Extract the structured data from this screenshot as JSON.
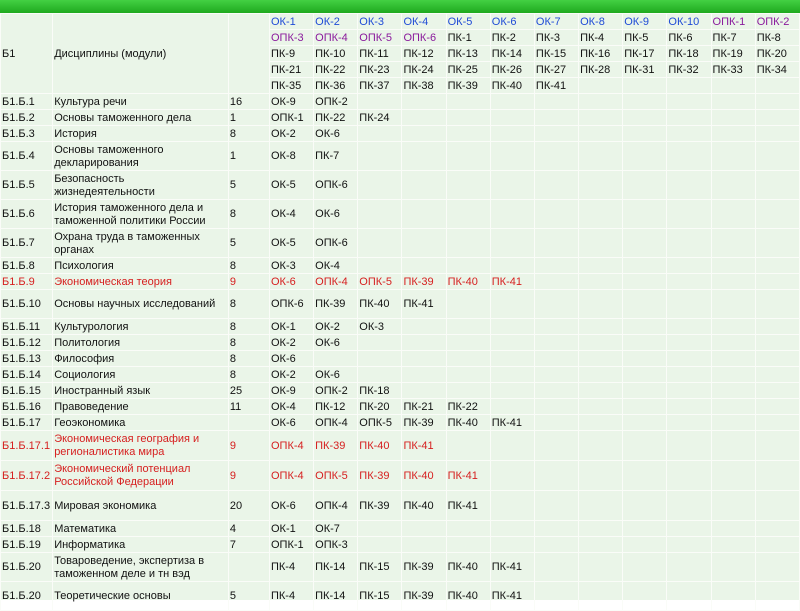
{
  "header": {
    "code": "Б1",
    "title": "Дисциплины (модули)",
    "rows": [
      [
        {
          "t": "ОК-1",
          "c": "blue"
        },
        {
          "t": "ОК-2",
          "c": "blue"
        },
        {
          "t": "ОК-3",
          "c": "blue"
        },
        {
          "t": "ОК-4",
          "c": "blue"
        },
        {
          "t": "ОК-5",
          "c": "blue"
        },
        {
          "t": "ОК-6",
          "c": "blue"
        },
        {
          "t": "ОК-7",
          "c": "blue"
        },
        {
          "t": "ОК-8",
          "c": "blue"
        },
        {
          "t": "ОК-9",
          "c": "blue"
        },
        {
          "t": "ОК-10",
          "c": "blue"
        },
        {
          "t": "ОПК-1",
          "c": "purple"
        },
        {
          "t": "ОПК-2",
          "c": "purple"
        }
      ],
      [
        {
          "t": "ОПК-3",
          "c": "purple"
        },
        {
          "t": "ОПК-4",
          "c": "purple"
        },
        {
          "t": "ОПК-5",
          "c": "purple"
        },
        {
          "t": "ОПК-6",
          "c": "purple"
        },
        {
          "t": "ПК-1",
          "c": ""
        },
        {
          "t": "ПК-2",
          "c": ""
        },
        {
          "t": "ПК-3",
          "c": ""
        },
        {
          "t": "ПК-4",
          "c": ""
        },
        {
          "t": "ПК-5",
          "c": ""
        },
        {
          "t": "ПК-6",
          "c": ""
        },
        {
          "t": "ПК-7",
          "c": ""
        },
        {
          "t": "ПК-8",
          "c": ""
        }
      ],
      [
        {
          "t": "ПК-9",
          "c": ""
        },
        {
          "t": "ПК-10",
          "c": ""
        },
        {
          "t": "ПК-11",
          "c": ""
        },
        {
          "t": "ПК-12",
          "c": ""
        },
        {
          "t": "ПК-13",
          "c": ""
        },
        {
          "t": "ПК-14",
          "c": ""
        },
        {
          "t": "ПК-15",
          "c": ""
        },
        {
          "t": "ПК-16",
          "c": ""
        },
        {
          "t": "ПК-17",
          "c": ""
        },
        {
          "t": "ПК-18",
          "c": ""
        },
        {
          "t": "ПК-19",
          "c": ""
        },
        {
          "t": "ПК-20",
          "c": ""
        }
      ],
      [
        {
          "t": "ПК-21",
          "c": ""
        },
        {
          "t": "ПК-22",
          "c": ""
        },
        {
          "t": "ПК-23",
          "c": ""
        },
        {
          "t": "ПК-24",
          "c": ""
        },
        {
          "t": "ПК-25",
          "c": ""
        },
        {
          "t": "ПК-26",
          "c": ""
        },
        {
          "t": "ПК-27",
          "c": ""
        },
        {
          "t": "ПК-28",
          "c": ""
        },
        {
          "t": "ПК-31",
          "c": ""
        },
        {
          "t": "ПК-32",
          "c": ""
        },
        {
          "t": "ПК-33",
          "c": ""
        },
        {
          "t": "ПК-34",
          "c": ""
        }
      ],
      [
        {
          "t": "ПК-35",
          "c": ""
        },
        {
          "t": "ПК-36",
          "c": ""
        },
        {
          "t": "ПК-37",
          "c": ""
        },
        {
          "t": "ПК-38",
          "c": ""
        },
        {
          "t": "ПК-39",
          "c": ""
        },
        {
          "t": "ПК-40",
          "c": ""
        },
        {
          "t": "ПК-41",
          "c": ""
        },
        {
          "t": "",
          "c": ""
        },
        {
          "t": "",
          "c": ""
        },
        {
          "t": "",
          "c": ""
        },
        {
          "t": "",
          "c": ""
        },
        {
          "t": "",
          "c": ""
        }
      ]
    ]
  },
  "rows": [
    {
      "code": "Б1.Б.1",
      "name": "Культура речи",
      "hours": "16",
      "comps": [
        "ОК-9",
        "ОПК-2"
      ],
      "red": false,
      "h": 1
    },
    {
      "code": "Б1.Б.2",
      "name": "Основы таможенного дела",
      "hours": "1",
      "comps": [
        "ОПК-1",
        "ПК-22",
        "ПК-24"
      ],
      "red": false,
      "h": 1
    },
    {
      "code": "Б1.Б.3",
      "name": "История",
      "hours": "8",
      "comps": [
        "ОК-2",
        "ОК-6"
      ],
      "red": false,
      "h": 1
    },
    {
      "code": "Б1.Б.4",
      "name": "Основы таможенного декларирования",
      "hours": "1",
      "comps": [
        "ОК-8",
        "ПК-7"
      ],
      "red": false,
      "h": 2
    },
    {
      "code": "Б1.Б.5",
      "name": "Безопасность жизнедеятельности",
      "hours": "5",
      "comps": [
        "ОК-5",
        "ОПК-6"
      ],
      "red": false,
      "h": 2
    },
    {
      "code": "Б1.Б.6",
      "name": "История таможенного дела и таможенной политики России",
      "hours": "8",
      "comps": [
        "ОК-4",
        "ОК-6"
      ],
      "red": false,
      "h": 2
    },
    {
      "code": "Б1.Б.7",
      "name": "Охрана труда в таможенных органах",
      "hours": "5",
      "comps": [
        "ОК-5",
        "ОПК-6"
      ],
      "red": false,
      "h": 2
    },
    {
      "code": "Б1.Б.8",
      "name": "Психология",
      "hours": "8",
      "comps": [
        "ОК-3",
        "ОК-4"
      ],
      "red": false,
      "h": 1
    },
    {
      "code": "Б1.Б.9",
      "name": "Экономическая теория",
      "hours": "9",
      "comps": [
        "ОК-6",
        "ОПК-4",
        "ОПК-5",
        "ПК-39",
        "ПК-40",
        "ПК-41"
      ],
      "red": true,
      "h": 1
    },
    {
      "code": "Б1.Б.10",
      "name": "Основы научных исследований",
      "hours": "8",
      "comps": [
        "ОПК-6",
        "ПК-39",
        "ПК-40",
        "ПК-41"
      ],
      "red": false,
      "h": 2
    },
    {
      "code": "Б1.Б.11",
      "name": "Культурология",
      "hours": "8",
      "comps": [
        "ОК-1",
        "ОК-2",
        "ОК-3"
      ],
      "red": false,
      "h": 1
    },
    {
      "code": "Б1.Б.12",
      "name": "Политология",
      "hours": "8",
      "comps": [
        "ОК-2",
        "ОК-6"
      ],
      "red": false,
      "h": 1
    },
    {
      "code": "Б1.Б.13",
      "name": "Философия",
      "hours": "8",
      "comps": [
        "ОК-6"
      ],
      "red": false,
      "h": 1
    },
    {
      "code": "Б1.Б.14",
      "name": "Социология",
      "hours": "8",
      "comps": [
        "ОК-2",
        "ОК-6"
      ],
      "red": false,
      "h": 1
    },
    {
      "code": "Б1.Б.15",
      "name": "Иностранный язык",
      "hours": "25",
      "comps": [
        "ОК-9",
        "ОПК-2",
        "ПК-18"
      ],
      "red": false,
      "h": 1
    },
    {
      "code": "Б1.Б.16",
      "name": "Правоведение",
      "hours": "11",
      "comps": [
        "ОК-4",
        "ПК-12",
        "ПК-20",
        "ПК-21",
        "ПК-22"
      ],
      "red": false,
      "h": 1
    },
    {
      "code": "Б1.Б.17",
      "name": "Геоэкономика",
      "hours": "",
      "comps": [
        "ОК-6",
        "ОПК-4",
        "ОПК-5",
        "ПК-39",
        "ПК-40",
        "ПК-41"
      ],
      "red": false,
      "h": 1
    },
    {
      "code": "Б1.Б.17.1",
      "name": "Экономическая география и регионалистика мира",
      "hours": "9",
      "comps": [
        "ОПК-4",
        "ПК-39",
        "ПК-40",
        "ПК-41"
      ],
      "red": true,
      "h": 3
    },
    {
      "code": "Б1.Б.17.2",
      "name": "Экономический потенциал Российской Федерации",
      "hours": "9",
      "comps": [
        "ОПК-4",
        "ОПК-5",
        "ПК-39",
        "ПК-40",
        "ПК-41"
      ],
      "red": true,
      "h": 3
    },
    {
      "code": "Б1.Б.17.3",
      "name": "Мировая экономика",
      "hours": "20",
      "comps": [
        "ОК-6",
        "ОПК-4",
        "ПК-39",
        "ПК-40",
        "ПК-41"
      ],
      "red": false,
      "h": 3
    },
    {
      "code": "Б1.Б.18",
      "name": "Математика",
      "hours": "4",
      "comps": [
        "ОК-1",
        "ОК-7"
      ],
      "red": false,
      "h": 1
    },
    {
      "code": "Б1.Б.19",
      "name": "Информатика",
      "hours": "7",
      "comps": [
        "ОПК-1",
        "ОПК-3"
      ],
      "red": false,
      "h": 1
    },
    {
      "code": "Б1.Б.20",
      "name": "Товароведение, экспертиза в таможенном деле и тн вэд",
      "hours": "",
      "comps": [
        "ПК-4",
        "ПК-14",
        "ПК-15",
        "ПК-39",
        "ПК-40",
        "ПК-41"
      ],
      "red": false,
      "h": 2
    },
    {
      "code": "Б1.Б.20",
      "name": "Теоретические основы",
      "hours": "5",
      "comps": [
        "ПК-4",
        "ПК-14",
        "ПК-15",
        "ПК-39",
        "ПК-40",
        "ПК-41"
      ],
      "red": false,
      "h": 2
    }
  ]
}
